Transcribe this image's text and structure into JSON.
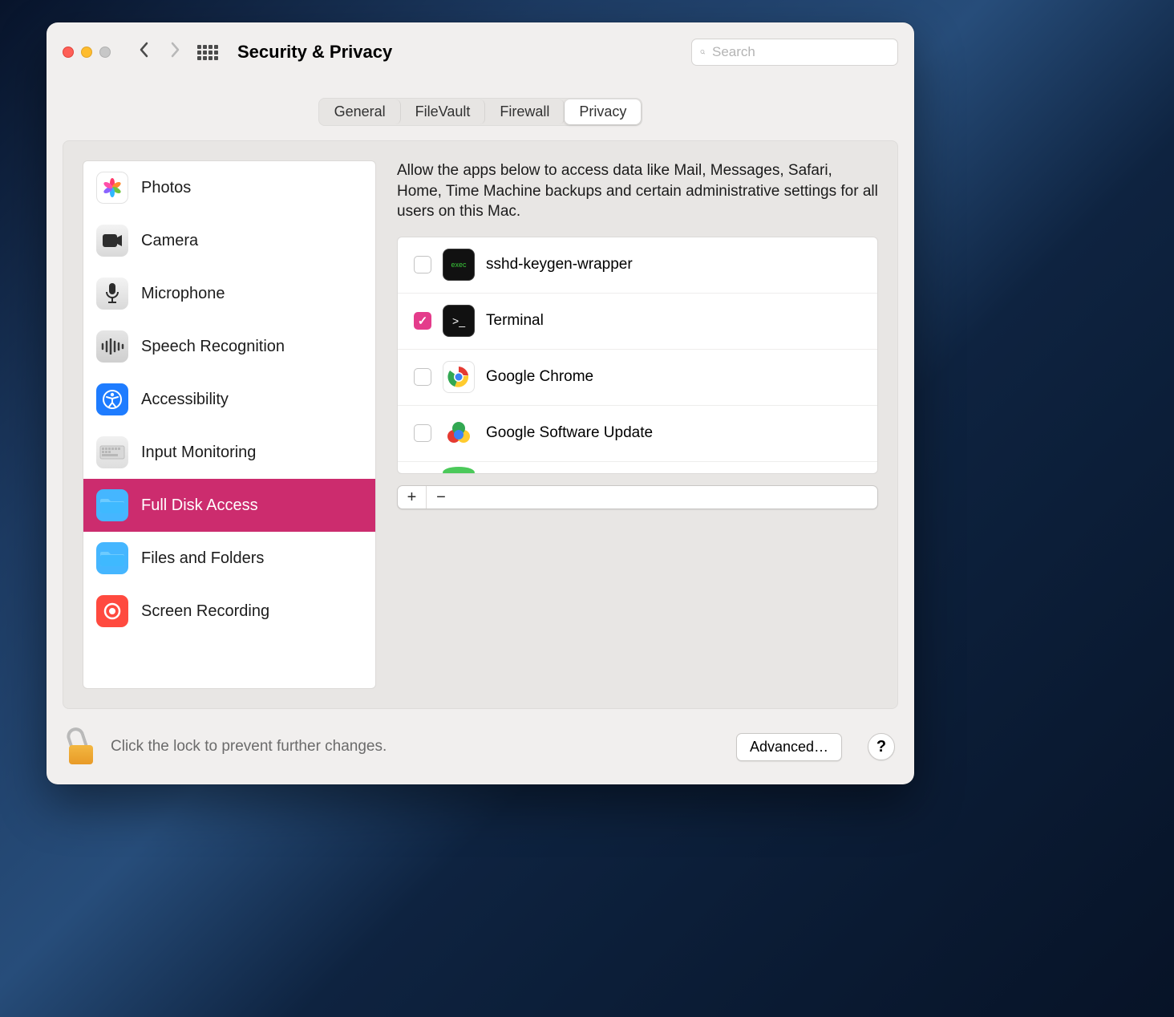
{
  "window": {
    "title": "Security & Privacy"
  },
  "search": {
    "placeholder": "Search"
  },
  "tabs": {
    "general": "General",
    "filevault": "FileVault",
    "firewall": "Firewall",
    "privacy": "Privacy"
  },
  "sidebar": {
    "items": [
      {
        "label": "Photos"
      },
      {
        "label": "Camera"
      },
      {
        "label": "Microphone"
      },
      {
        "label": "Speech Recognition"
      },
      {
        "label": "Accessibility"
      },
      {
        "label": "Input Monitoring"
      },
      {
        "label": "Full Disk Access"
      },
      {
        "label": "Files and Folders"
      },
      {
        "label": "Screen Recording"
      }
    ]
  },
  "description": "Allow the apps below to access data like Mail, Messages, Safari, Home, Time Machine backups and certain administrative settings for all users on this Mac.",
  "apps": [
    {
      "name": "sshd-keygen-wrapper",
      "checked": false
    },
    {
      "name": "Terminal",
      "checked": true
    },
    {
      "name": "Google Chrome",
      "checked": false
    },
    {
      "name": "Google Software Update",
      "checked": false
    }
  ],
  "footer": {
    "lock_text": "Click the lock to prevent further changes.",
    "advanced": "Advanced…",
    "help": "?"
  },
  "buttons": {
    "add": "+",
    "remove": "−"
  }
}
